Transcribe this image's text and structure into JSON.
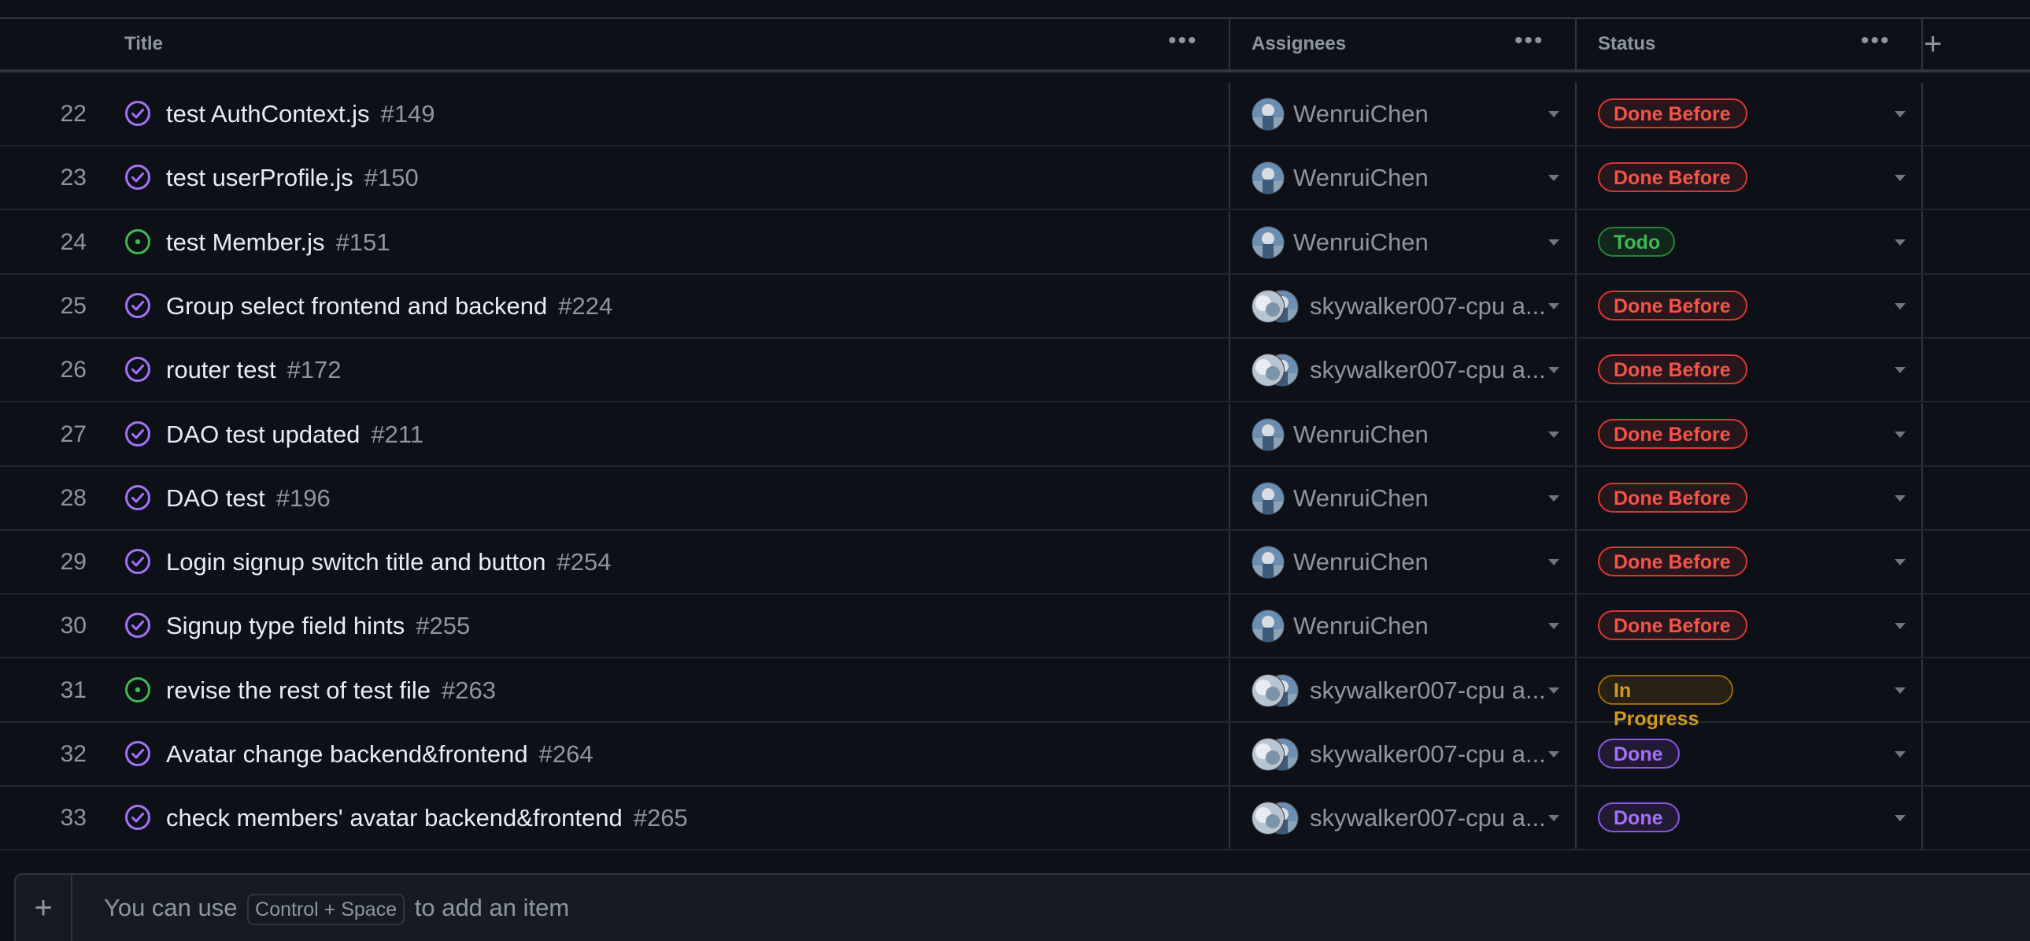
{
  "columns": {
    "title": "Title",
    "assignees": "Assignees",
    "status": "Status",
    "more_icon": "kebab-horizontal-icon",
    "add_icon": "plus-icon"
  },
  "status_colors": {
    "Done Before": {
      "fg": "#f85149",
      "border": "#da3633",
      "bg": "#25171c"
    },
    "Todo": {
      "fg": "#3fb950",
      "border": "#238636",
      "bg": "#12261e"
    },
    "In Progress": {
      "fg": "#d29922",
      "border": "#9e6a03",
      "bg": "#272115"
    },
    "Done": {
      "fg": "#a371f7",
      "border": "#8957e5",
      "bg": "#221a33"
    }
  },
  "rows": [
    {
      "num": "22",
      "state": "closed",
      "title": "test AuthContext.js",
      "issue": "#149",
      "assignee": "WenruiChen",
      "multi": false,
      "status": "Done Before"
    },
    {
      "num": "23",
      "state": "closed",
      "title": "test userProfile.js",
      "issue": "#150",
      "assignee": "WenruiChen",
      "multi": false,
      "status": "Done Before"
    },
    {
      "num": "24",
      "state": "open",
      "title": "test Member.js",
      "issue": "#151",
      "assignee": "WenruiChen",
      "multi": false,
      "status": "Todo"
    },
    {
      "num": "25",
      "state": "closed",
      "title": "Group select frontend and backend",
      "issue": "#224",
      "assignee": "skywalker007-cpu a...",
      "multi": true,
      "status": "Done Before"
    },
    {
      "num": "26",
      "state": "closed",
      "title": "router test",
      "issue": "#172",
      "assignee": "skywalker007-cpu a...",
      "multi": true,
      "status": "Done Before"
    },
    {
      "num": "27",
      "state": "closed",
      "title": "DAO test updated",
      "issue": "#211",
      "assignee": "WenruiChen",
      "multi": false,
      "status": "Done Before"
    },
    {
      "num": "28",
      "state": "closed",
      "title": "DAO test",
      "issue": "#196",
      "assignee": "WenruiChen",
      "multi": false,
      "status": "Done Before"
    },
    {
      "num": "29",
      "state": "closed",
      "title": "Login signup switch title and button",
      "issue": "#254",
      "assignee": "WenruiChen",
      "multi": false,
      "status": "Done Before"
    },
    {
      "num": "30",
      "state": "closed",
      "title": "Signup type field hints",
      "issue": "#255",
      "assignee": "WenruiChen",
      "multi": false,
      "status": "Done Before"
    },
    {
      "num": "31",
      "state": "open",
      "title": "revise the rest of test file",
      "issue": "#263",
      "assignee": "skywalker007-cpu a...",
      "multi": true,
      "status": "In Progress"
    },
    {
      "num": "32",
      "state": "closed",
      "title": "Avatar change backend&frontend",
      "issue": "#264",
      "assignee": "skywalker007-cpu a...",
      "multi": true,
      "status": "Done"
    },
    {
      "num": "33",
      "state": "closed",
      "title": "check members' avatar backend&frontend",
      "issue": "#265",
      "assignee": "skywalker007-cpu a...",
      "multi": true,
      "status": "Done"
    }
  ],
  "footer": {
    "prefix": "You can use",
    "shortcut": "Control + Space",
    "suffix": "to add an item",
    "add_icon": "plus-icon"
  }
}
